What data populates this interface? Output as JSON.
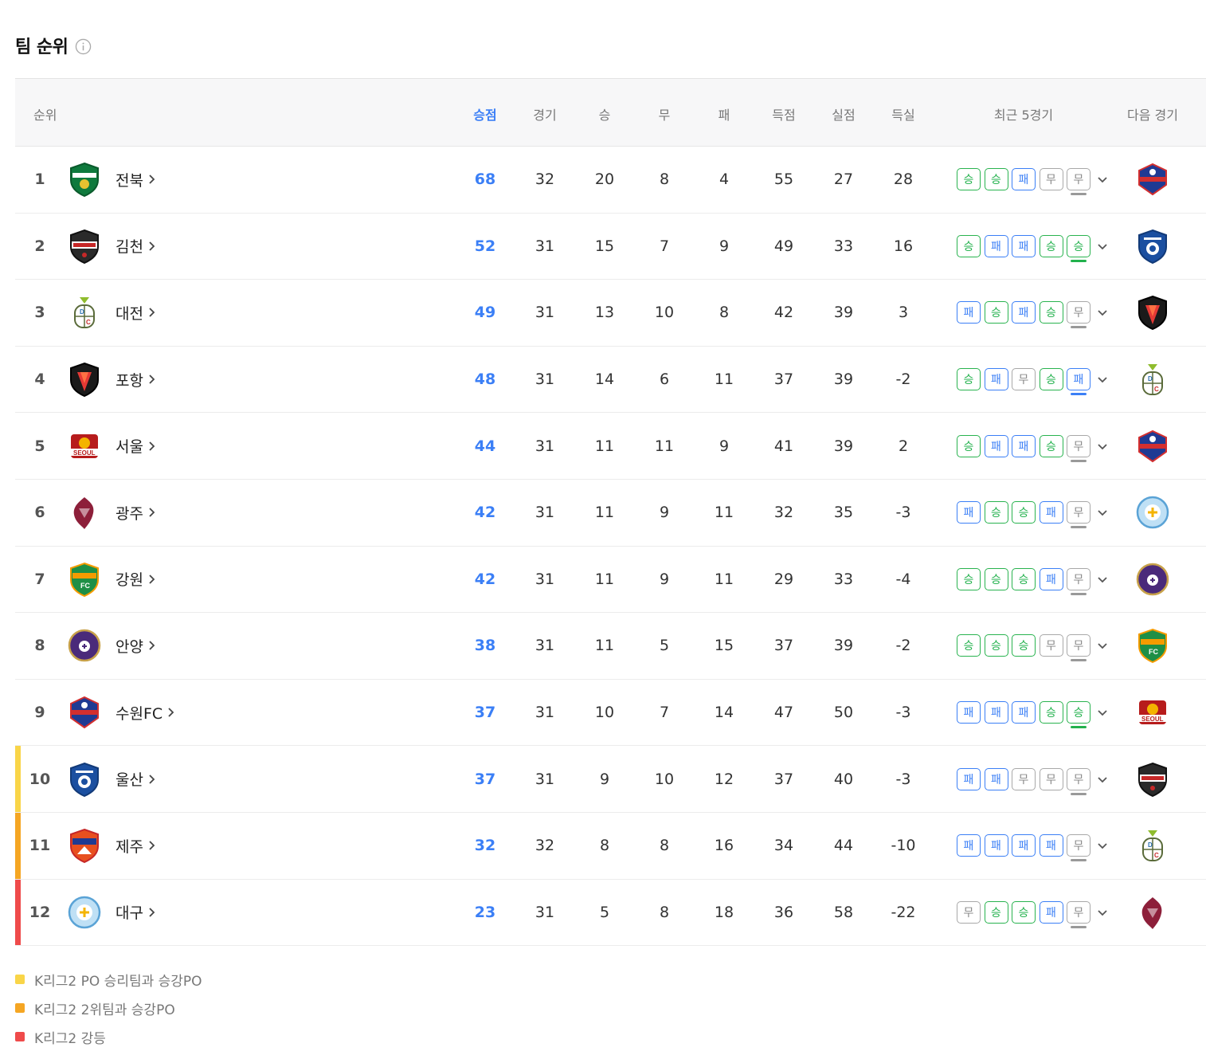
{
  "title": "팀 순위",
  "headers": {
    "rank": "순위",
    "points": "승점",
    "played": "경기",
    "wins": "승",
    "draws": "무",
    "losses": "패",
    "goals_for": "득점",
    "goals_against": "실점",
    "goal_diff": "득실",
    "recent": "최근 5경기",
    "next": "다음 경기"
  },
  "result_labels": {
    "W": "승",
    "L": "패",
    "D": "무"
  },
  "colors": {
    "accent_blue": "#3b7ff6",
    "win_green": "#22b14c",
    "zone_po_winner": "#f9d548",
    "zone_po_second": "#f5a623",
    "zone_relegation": "#ef4b4b"
  },
  "rows": [
    {
      "rank": "1",
      "team": "전북",
      "logo": "jeonbuk-logo",
      "points": "68",
      "played": "32",
      "wins": "20",
      "draws": "8",
      "losses": "4",
      "gf": "55",
      "ga": "27",
      "gd": "28",
      "recent": [
        "W",
        "W",
        "L",
        "D",
        "D"
      ],
      "next_logo": "suwon-fc-logo",
      "zone": ""
    },
    {
      "rank": "2",
      "team": "김천",
      "logo": "gimcheon-logo",
      "points": "52",
      "played": "31",
      "wins": "15",
      "draws": "7",
      "losses": "9",
      "gf": "49",
      "ga": "33",
      "gd": "16",
      "recent": [
        "W",
        "L",
        "L",
        "W",
        "W"
      ],
      "next_logo": "ulsan-logo",
      "zone": ""
    },
    {
      "rank": "3",
      "team": "대전",
      "logo": "daejeon-logo",
      "points": "49",
      "played": "31",
      "wins": "13",
      "draws": "10",
      "losses": "8",
      "gf": "42",
      "ga": "39",
      "gd": "3",
      "recent": [
        "L",
        "W",
        "L",
        "W",
        "D"
      ],
      "next_logo": "pohang-logo",
      "zone": ""
    },
    {
      "rank": "4",
      "team": "포항",
      "logo": "pohang-logo",
      "points": "48",
      "played": "31",
      "wins": "14",
      "draws": "6",
      "losses": "11",
      "gf": "37",
      "ga": "39",
      "gd": "-2",
      "recent": [
        "W",
        "L",
        "D",
        "W",
        "L"
      ],
      "next_logo": "daejeon-logo",
      "zone": ""
    },
    {
      "rank": "5",
      "team": "서울",
      "logo": "seoul-logo",
      "points": "44",
      "played": "31",
      "wins": "11",
      "draws": "11",
      "losses": "9",
      "gf": "41",
      "ga": "39",
      "gd": "2",
      "recent": [
        "W",
        "L",
        "L",
        "W",
        "D"
      ],
      "next_logo": "suwon-fc-logo",
      "zone": ""
    },
    {
      "rank": "6",
      "team": "광주",
      "logo": "gwangju-logo",
      "points": "42",
      "played": "31",
      "wins": "11",
      "draws": "9",
      "losses": "11",
      "gf": "32",
      "ga": "35",
      "gd": "-3",
      "recent": [
        "L",
        "W",
        "W",
        "L",
        "D"
      ],
      "next_logo": "daegu-logo",
      "zone": ""
    },
    {
      "rank": "7",
      "team": "강원",
      "logo": "gangwon-logo",
      "points": "42",
      "played": "31",
      "wins": "11",
      "draws": "9",
      "losses": "11",
      "gf": "29",
      "ga": "33",
      "gd": "-4",
      "recent": [
        "W",
        "W",
        "W",
        "L",
        "D"
      ],
      "next_logo": "anyang-logo",
      "zone": ""
    },
    {
      "rank": "8",
      "team": "안양",
      "logo": "anyang-logo",
      "points": "38",
      "played": "31",
      "wins": "11",
      "draws": "5",
      "losses": "15",
      "gf": "37",
      "ga": "39",
      "gd": "-2",
      "recent": [
        "W",
        "W",
        "W",
        "D",
        "D"
      ],
      "next_logo": "gangwon-logo",
      "zone": ""
    },
    {
      "rank": "9",
      "team": "수원FC",
      "logo": "suwon-fc-logo",
      "points": "37",
      "played": "31",
      "wins": "10",
      "draws": "7",
      "losses": "14",
      "gf": "47",
      "ga": "50",
      "gd": "-3",
      "recent": [
        "L",
        "L",
        "L",
        "W",
        "W"
      ],
      "next_logo": "seoul-logo",
      "zone": ""
    },
    {
      "rank": "10",
      "team": "울산",
      "logo": "ulsan-logo",
      "points": "37",
      "played": "31",
      "wins": "9",
      "draws": "10",
      "losses": "12",
      "gf": "37",
      "ga": "40",
      "gd": "-3",
      "recent": [
        "L",
        "L",
        "D",
        "D",
        "D"
      ],
      "next_logo": "gimcheon-logo",
      "zone": "#f9d548"
    },
    {
      "rank": "11",
      "team": "제주",
      "logo": "jeju-logo",
      "points": "32",
      "played": "32",
      "wins": "8",
      "draws": "8",
      "losses": "16",
      "gf": "34",
      "ga": "44",
      "gd": "-10",
      "recent": [
        "L",
        "L",
        "L",
        "L",
        "D"
      ],
      "next_logo": "daejeon-logo",
      "zone": "#f5a623"
    },
    {
      "rank": "12",
      "team": "대구",
      "logo": "daegu-logo",
      "points": "23",
      "played": "31",
      "wins": "5",
      "draws": "8",
      "losses": "18",
      "gf": "36",
      "ga": "58",
      "gd": "-22",
      "recent": [
        "D",
        "W",
        "W",
        "L",
        "D"
      ],
      "next_logo": "gwangju-logo",
      "zone": "#ef4b4b"
    }
  ],
  "legend": [
    {
      "color": "#f9d548",
      "text": "K리그2 PO 승리팀과 승강PO"
    },
    {
      "color": "#f5a623",
      "text": "K리그2 2위팀과 승강PO"
    },
    {
      "color": "#ef4b4b",
      "text": "K리그2 강등"
    }
  ]
}
